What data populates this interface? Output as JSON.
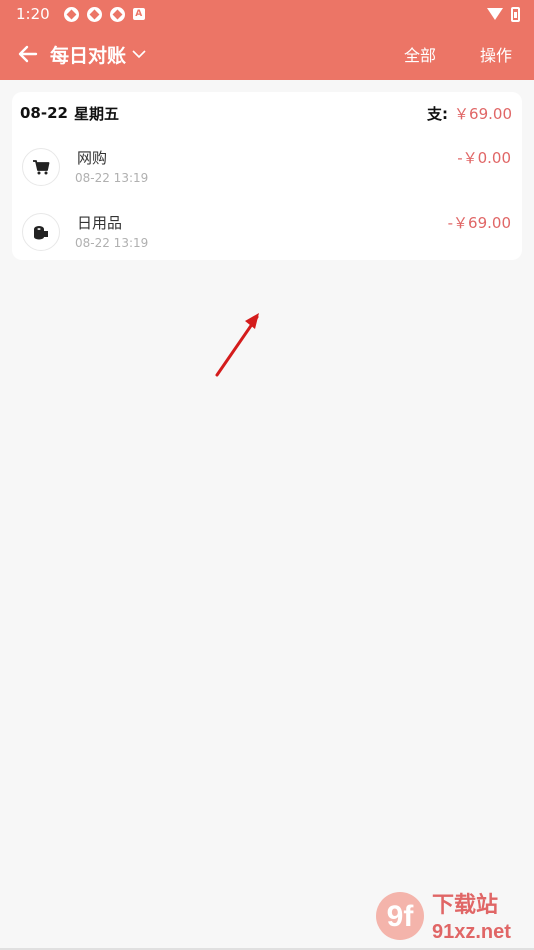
{
  "status_bar": {
    "time": "1:20",
    "badge": "A"
  },
  "app_bar": {
    "title": "每日对账",
    "actions": [
      "全部",
      "操作"
    ]
  },
  "day_card": {
    "date": "08-22",
    "weekday": "星期五",
    "expense_label": "支:",
    "expense_amount": "￥69.00",
    "entries": [
      {
        "name": "网购",
        "time": "08-22 13:19",
        "amount": "-￥0.00",
        "icon": "shopping-cart-icon"
      },
      {
        "name": "日用品",
        "time": "08-22 13:19",
        "amount": "-￥69.00",
        "icon": "toilet-paper-icon"
      }
    ]
  },
  "watermark": {
    "logo_text": "9f",
    "cn_text": "下载站",
    "domain": "91xz.net"
  },
  "colors": {
    "primary": "#ec7566",
    "amount": "#e06666",
    "background": "#f7f7f7"
  }
}
